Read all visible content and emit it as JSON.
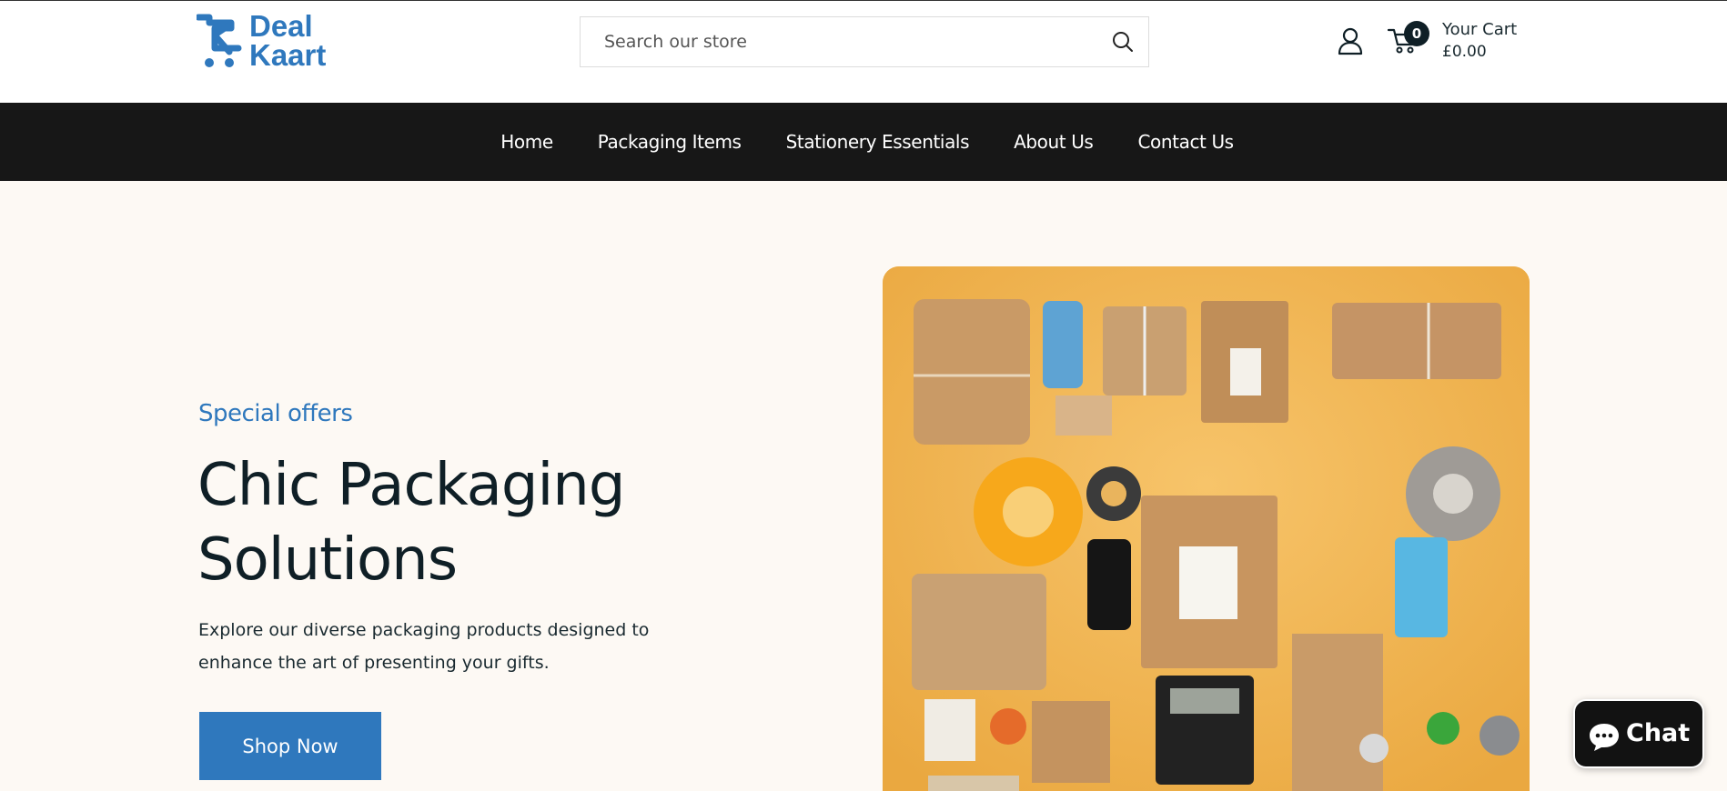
{
  "brand": {
    "logo_line1": "Deal",
    "logo_line2": "Kaart",
    "color": "#2f78bd"
  },
  "header": {
    "search_placeholder": "Search our store",
    "search_icon": "search-icon",
    "account_icon": "user-icon",
    "cart_icon": "cart-icon",
    "cart_count": "0",
    "cart_label": "Your Cart",
    "cart_total": "£0.00"
  },
  "nav": {
    "items": [
      {
        "label": "Home"
      },
      {
        "label": "Packaging Items"
      },
      {
        "label": "Stationery Essentials"
      },
      {
        "label": "About Us"
      },
      {
        "label": "Contact Us"
      }
    ]
  },
  "hero": {
    "kicker": "Special offers",
    "headline": "Chic Packaging Solutions",
    "description": "Explore our diverse packaging products designed to enhance the art of presenting your gifts.",
    "cta_label": "Shop Now",
    "image_name": "packaging-flatlay-image"
  },
  "chat": {
    "label": "Chat",
    "icon": "chat-bubble-icon"
  },
  "colors": {
    "accent": "#2f78bd",
    "nav_bg": "#171717",
    "page_bg": "#fdf9f4",
    "hero_image_bg": "#f0b451"
  }
}
